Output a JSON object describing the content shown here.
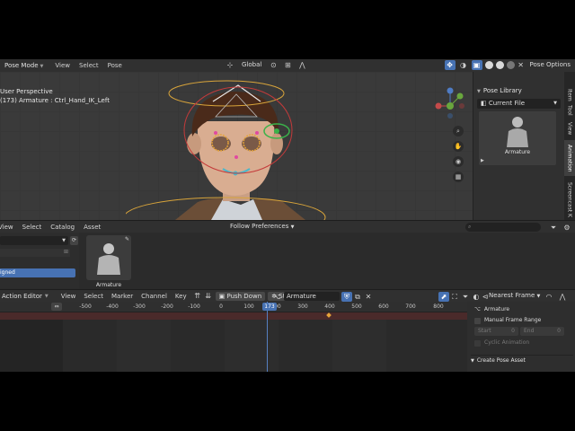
{
  "viewport_header": {
    "mode": "Pose Mode",
    "menus": [
      "View",
      "Select",
      "Pose"
    ],
    "transform_orientation": "Global",
    "pose_options": "Pose Options"
  },
  "viewport": {
    "view_name": "User Perspective",
    "active_info": "(173) Armature : Ctrl_Hand_IK_Left",
    "gizmo_axes": [
      "Z",
      "Y",
      "X"
    ]
  },
  "npanel": {
    "panel_title": "Pose Library",
    "library_select": "Current File",
    "asset_label": "Armature",
    "tabs": [
      "Item",
      "Tool",
      "View",
      "Animation",
      "Screencast K"
    ],
    "active_tab": "Animation"
  },
  "asset_browser": {
    "menus": [
      "View",
      "Select",
      "Catalog",
      "Asset"
    ],
    "filter": "Follow Preferences",
    "left_selected": "igned",
    "asset_label": "Armature"
  },
  "action_editor": {
    "mode": "Action Editor",
    "menus": [
      "View",
      "Select",
      "Marker",
      "Channel",
      "Key"
    ],
    "push_down": "Push Down",
    "stash": "Stash",
    "action_name": "Armature",
    "snap": "Nearest Frame",
    "current_frame": "173",
    "ruler_ticks": [
      "-500",
      "-400",
      "-300",
      "-200",
      "-100",
      "0",
      "100",
      "200",
      "300",
      "400",
      "500",
      "600",
      "700",
      "800"
    ]
  },
  "action_panel": {
    "object": "Armature",
    "manual_frame_range": "Manual Frame Range",
    "start_label": "Start",
    "start_value": "0",
    "end_label": "End",
    "end_value": "0",
    "cyclic": "Cyclic Animation",
    "create_pose_asset": "Create Pose Asset"
  },
  "colors": {
    "accent": "#4772b3",
    "keyframe": "#e8a43a",
    "summary_row": "#4a2a2a"
  }
}
